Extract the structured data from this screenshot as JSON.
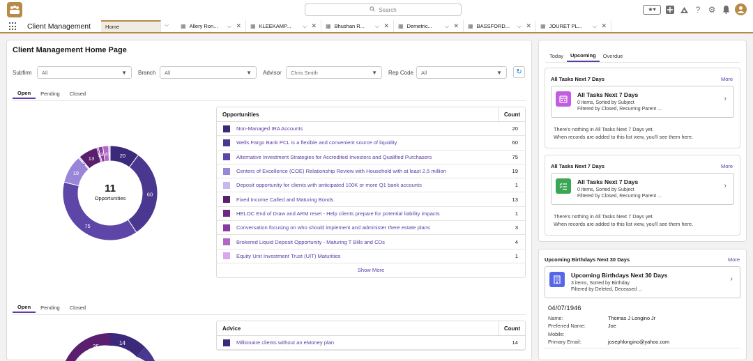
{
  "topbar": {
    "search_placeholder": "Search",
    "fav_label": "★▾",
    "avatar_initial": "●"
  },
  "nav": {
    "app_name": "Client Management",
    "tabs": [
      {
        "label": "Home"
      },
      {
        "label": "Allery Ron..."
      },
      {
        "label": "KLEEKAMP..."
      },
      {
        "label": "Bhushan R..."
      },
      {
        "label": "Demetric..."
      },
      {
        "label": "BASSFORD..."
      },
      {
        "label": "JOURET PL..."
      }
    ]
  },
  "page": {
    "title": "Client Management Home Page",
    "filters": [
      {
        "label": "Subfirm",
        "value": "All"
      },
      {
        "label": "Branch",
        "value": "All"
      },
      {
        "label": "Advisor",
        "value": "Chris Smith"
      },
      {
        "label": "Rep Code",
        "value": "All"
      }
    ]
  },
  "section1": {
    "tabs": [
      "Open",
      "Pending",
      "Closed"
    ],
    "center_value": "11",
    "center_label": "Opportunities",
    "table_header": "Opportunities",
    "count_header": "Count",
    "show_more": "Show More"
  },
  "section2": {
    "tabs": [
      "Open",
      "Pending",
      "Closed"
    ],
    "table_header": "Advice",
    "count_header": "Count"
  },
  "colors": {
    "accent": "#5a3ea6",
    "brand": "#b88a47"
  },
  "chart_data": [
    {
      "type": "pie",
      "title": "",
      "center_text": "11 Opportunities",
      "categories": [
        "Non-Managed IRA Accounts",
        "Wells Fargo Bank PCL is a flexible and convenient source of liquidity",
        "Alternative Investment Strategies for Accredited Investors and Qualified Purchasers",
        "Centers of Excellence (COE) Relationship Review with Household with at least 2.5 million",
        "Deposit opportunity for clients with anticipated 100K or more Q1 bank accounts",
        "Fixed Income Called and Maturing Bonds",
        "HELOC End of Draw and ARM reset - Help clients prepare for potential liability impacts",
        "Conversation focusing on who should implement and administer there estate plans",
        "Brokered Liquid Deposit Opportunity - Maturing T Bills and CDs",
        "Equity Unit Investment Trust (UIT) Maturities"
      ],
      "values": [
        20,
        60,
        75,
        19,
        1,
        13,
        1,
        3,
        4,
        1
      ],
      "colors": [
        "#3b2a7a",
        "#4a3890",
        "#5e46a8",
        "#9a86d8",
        "#c9b8ef",
        "#5a1f6e",
        "#6d2a85",
        "#8a3aa0",
        "#b068c4",
        "#dca6ee"
      ]
    },
    {
      "type": "pie",
      "title": "",
      "categories": [
        "Millionaire clients without an eMoney plan"
      ],
      "values": [
        14
      ],
      "visible_labels": [
        25,
        14
      ]
    }
  ],
  "section2_rows": [
    {
      "label": "Millionaire clients without an eMoney plan",
      "count": "14",
      "color": "#3b2a7a"
    }
  ],
  "right": {
    "tabs": [
      "Today",
      "Upcoming",
      "Overdue"
    ],
    "lists": [
      {
        "header": "All Tasks Next 7 Days",
        "more": "More",
        "title": "All Tasks Next 7 Days",
        "line1": "0 items, Sorted by Subject",
        "line2": "Filtered by Closed, Recurring Parent ...",
        "empty1": "There's nothing in All Tasks Next 7 Days yet.",
        "empty2": "When records are added to this list view, you'll see them here.",
        "icon_color": "#c25ce0"
      },
      {
        "header": "All Tasks Next 7 Days",
        "more": "More",
        "title": "All Tasks Next 7 Days",
        "line1": "0 items, Sorted by Subject",
        "line2": "Filtered by Closed, Recurring Parent ...",
        "empty1": "There's nothing in All Tasks Next 7 Days yet.",
        "empty2": "When records are added to this list view, you'll see them here.",
        "icon_color": "#3ba755"
      }
    ],
    "birthdays": {
      "header": "Upcoming Birthdays Next 30 Days",
      "more": "More",
      "title": "Upcoming Birthdays Next 30 Days",
      "line1": "3 items, Sorted by Birthday",
      "line2": "Filtered by Deleted, Deceased ...",
      "icon_color": "#5867e8",
      "record": {
        "date": "04/07/1946",
        "fields": [
          {
            "key": "Name:",
            "value": "Thomas J Longino Jr"
          },
          {
            "key": "Preferred Name:",
            "value": "Joe"
          },
          {
            "key": "Mobile:",
            "value": ""
          },
          {
            "key": "Primary Email:",
            "value": "josephlongino@yahoo.com"
          }
        ]
      }
    }
  }
}
